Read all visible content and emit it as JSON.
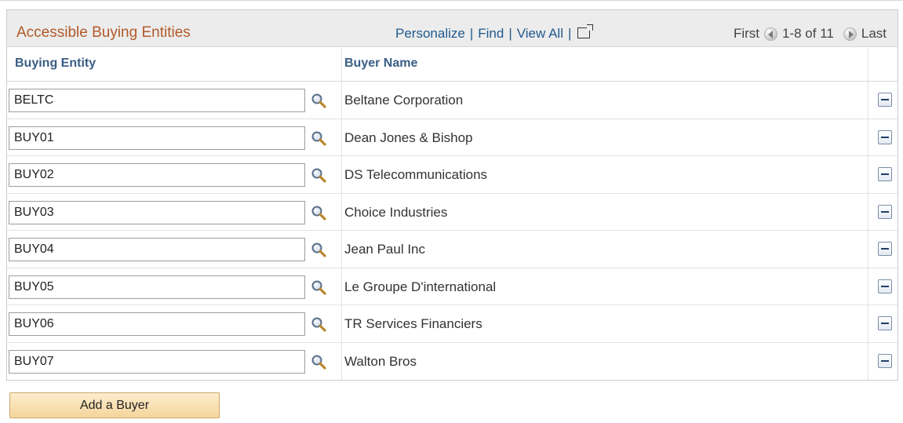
{
  "grid": {
    "title": "Accessible Buying Entities",
    "nav": {
      "personalize": "Personalize",
      "find": "Find",
      "view_all": "View All",
      "separator": "|"
    },
    "pager": {
      "first": "First",
      "range": "1-8 of 11",
      "last": "Last"
    },
    "columns": {
      "buying_entity": "Buying Entity",
      "buyer_name": "Buyer Name"
    },
    "rows": [
      {
        "entity": "BELTC",
        "name": "Beltane Corporation"
      },
      {
        "entity": "BUY01",
        "name": "Dean Jones & Bishop"
      },
      {
        "entity": "BUY02",
        "name": "DS Telecommunications"
      },
      {
        "entity": "BUY03",
        "name": "Choice Industries"
      },
      {
        "entity": "BUY04",
        "name": "Jean Paul Inc"
      },
      {
        "entity": "BUY05",
        "name": "Le Groupe D'international"
      },
      {
        "entity": "BUY06",
        "name": "TR Services Financiers"
      },
      {
        "entity": "BUY07",
        "name": "Walton Bros"
      }
    ]
  },
  "actions": {
    "add_buyer": "Add a Buyer"
  },
  "icons": {
    "lookup": "magnifier-icon",
    "delete": "minus-icon",
    "popout": "new-window-icon",
    "prev": "left-arrow-icon",
    "next": "right-arrow-icon"
  },
  "colors": {
    "title": "#b15a2a",
    "link": "#1f5a8e",
    "column_header": "#3a5d85",
    "button_bg": "#f6d59c"
  }
}
